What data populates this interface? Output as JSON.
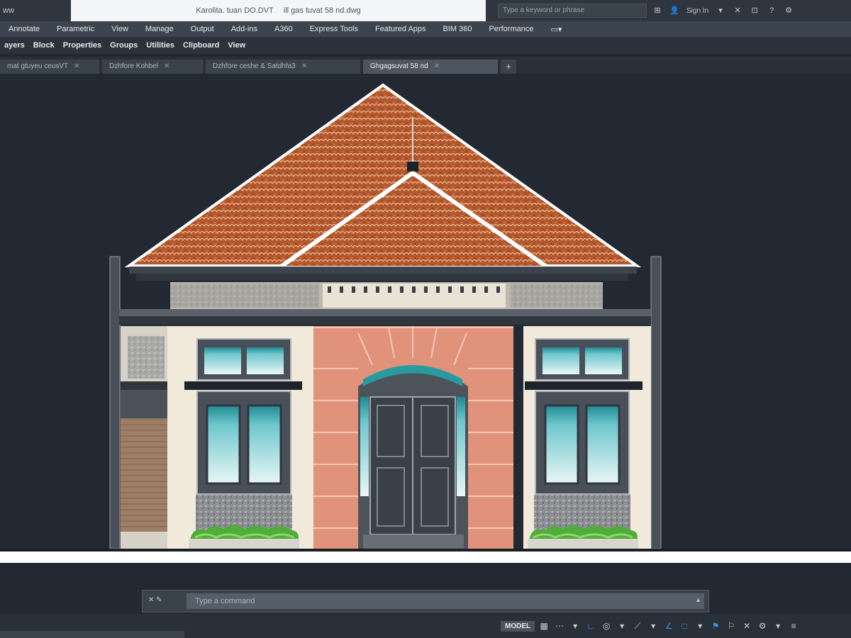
{
  "titlebar": {
    "app_label": "ww",
    "filename": "Karolita. tuan DO.DVT",
    "doc_name": "ill gas tuvat 58 nd.dwg",
    "search_placeholder": "Type a keyword or phrase",
    "sign_in": "Sign In"
  },
  "ribbon": {
    "tabs": [
      "Annotate",
      "Parametric",
      "View",
      "Manage",
      "Output",
      "Add-ins",
      "A360",
      "Express Tools",
      "Featured Apps",
      "BIM 360",
      "Performance"
    ]
  },
  "panels": {
    "items": [
      "ayers",
      "Block",
      "Properties",
      "Groups",
      "Utilities",
      "Clipboard",
      "View"
    ]
  },
  "doctabs": {
    "items": [
      {
        "label": "mat gtuyeu ceusVT"
      },
      {
        "label": "Dzhfore Kohbel"
      },
      {
        "label": "Dzhfore ceshe & Satdhfa3"
      },
      {
        "label": "Ghgagsuvat 58 nd"
      }
    ],
    "add_label": "+"
  },
  "commandline": {
    "close_label": "✕ ✎",
    "placeholder": "Type a command"
  },
  "statusbar": {
    "model_label": "MODEL"
  },
  "colors": {
    "background": "#222933",
    "roof_tile": "#b4582c",
    "pilaster": "#e0937a",
    "wall": "#f1eadb",
    "window_glass": "#6fc7cd",
    "planter_green": "#4fae3a",
    "accent_blue": "#3b8ee8"
  },
  "icons": {
    "close": "close-icon",
    "add": "add-icon",
    "grid": "grid-icon",
    "snap": "snap-icon"
  }
}
